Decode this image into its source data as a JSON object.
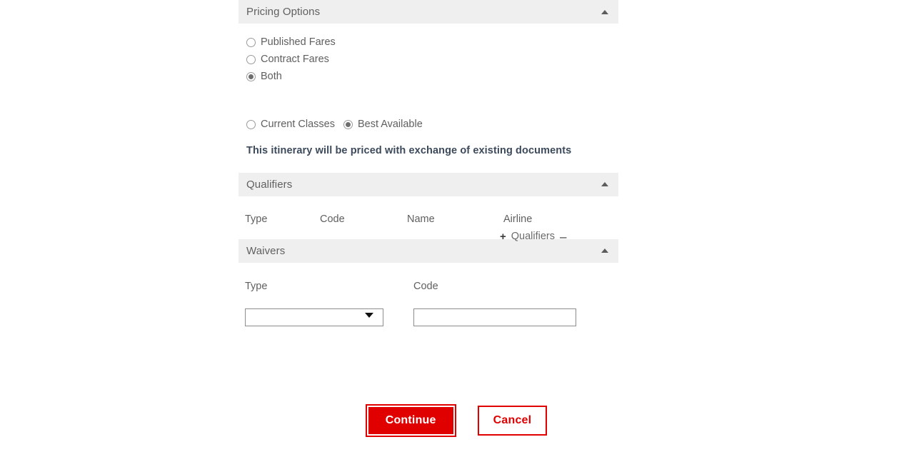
{
  "sections": {
    "pricing_options": {
      "title": "Pricing Options",
      "collapse_icon": "caret-up-icon",
      "fare_type": {
        "options": [
          {
            "label": "Published Fares",
            "selected": false
          },
          {
            "label": "Contract Fares",
            "selected": false
          },
          {
            "label": "Both",
            "selected": true
          }
        ]
      },
      "class_type": {
        "options": [
          {
            "label": "Current Classes",
            "selected": false
          },
          {
            "label": "Best Available",
            "selected": true
          }
        ]
      },
      "notice": "This itinerary will be priced with exchange of existing documents"
    },
    "qualifiers": {
      "title": "Qualifiers",
      "collapse_icon": "caret-up-icon",
      "columns": [
        "Type",
        "Code",
        "Name",
        "Airline"
      ],
      "actions": {
        "add": "+",
        "label": "Qualifiers",
        "remove": "–"
      }
    },
    "waivers": {
      "title": "Waivers",
      "collapse_icon": "caret-up-icon",
      "fields": {
        "type": {
          "label": "Type",
          "value": "",
          "options": [
            ""
          ]
        },
        "code": {
          "label": "Code",
          "value": "",
          "placeholder": ""
        }
      }
    }
  },
  "footer": {
    "continue_label": "Continue",
    "cancel_label": "Cancel"
  },
  "colors": {
    "accent_red": "#e00000",
    "header_bg": "#efefef",
    "notice_text": "#3c4a5c",
    "body_text": "#5f5f5f"
  }
}
